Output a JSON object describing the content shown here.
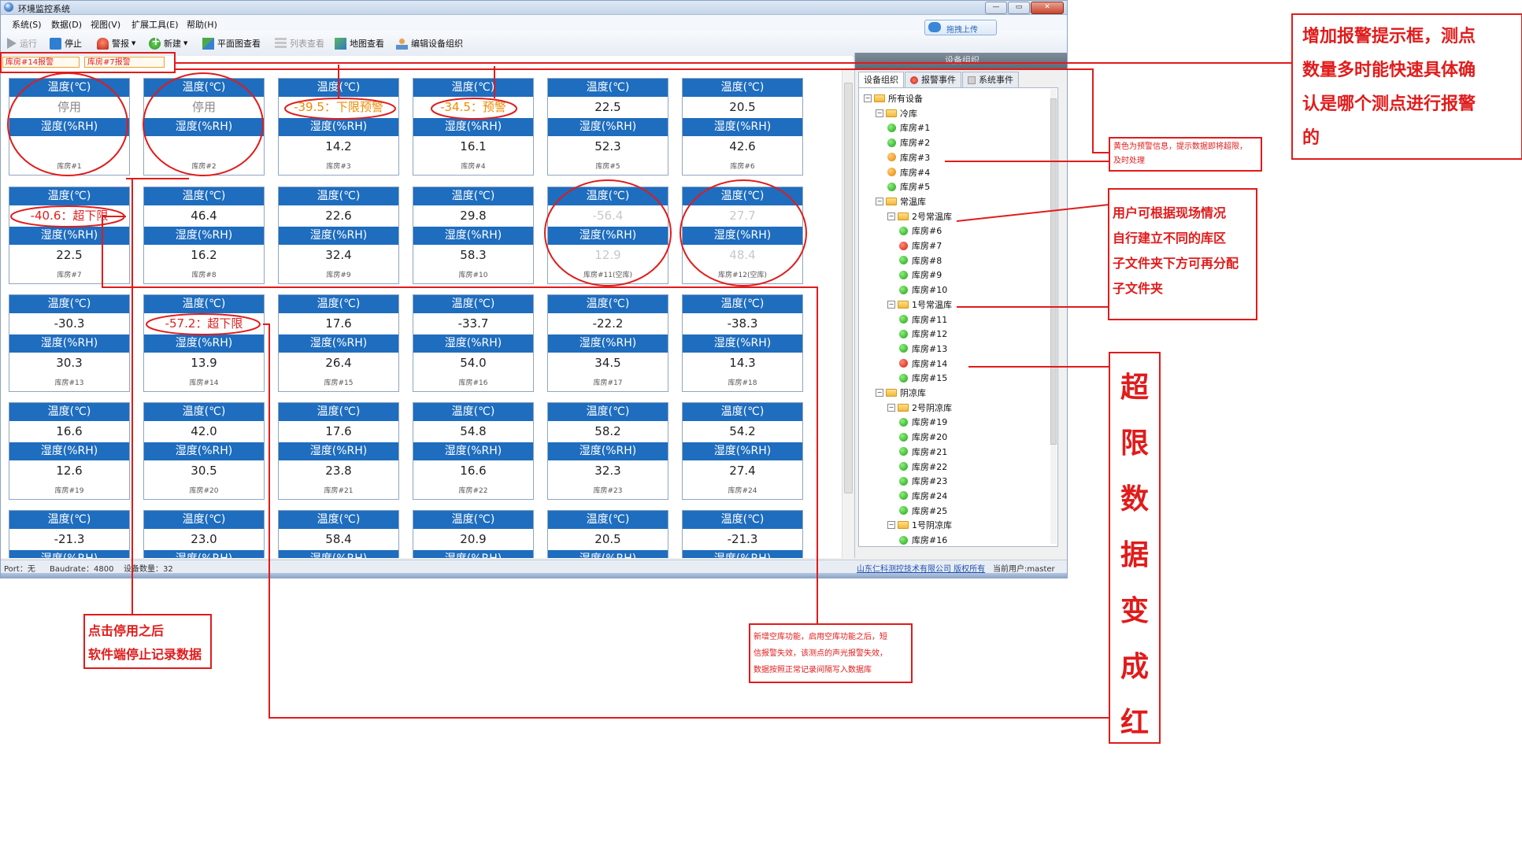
{
  "window": {
    "title": "环境监控系统",
    "buttons": [
      "—",
      "▭",
      "✕"
    ]
  },
  "menu": [
    "系统(S)",
    "数据(D)",
    "视图(V)",
    "扩展工具(E)",
    "帮助(H)"
  ],
  "toolbar": {
    "run": "运行",
    "stop": "停止",
    "alarm": "警报",
    "new": "新建",
    "plan": "平面图查看",
    "list": "列表查看",
    "map": "地图查看",
    "edit": "编辑设备组织",
    "upload": "拖拽上传"
  },
  "alarm_bar": [
    "库房#14报警",
    "库房#7报警"
  ],
  "labels": {
    "temp": "温度(℃)",
    "hum": "湿度(%RH)"
  },
  "cards": [
    {
      "name": "库房#1",
      "temp": "停用",
      "hum": "",
      "ts": "stop",
      "hs": ""
    },
    {
      "name": "库房#2",
      "temp": "停用",
      "hum": "",
      "ts": "stop",
      "hs": ""
    },
    {
      "name": "库房#3",
      "temp": "-39.5：下限预警",
      "hum": "14.2",
      "ts": "warn",
      "hs": ""
    },
    {
      "name": "库房#4",
      "temp": "-34.5：预警",
      "hum": "16.1",
      "ts": "warn",
      "hs": ""
    },
    {
      "name": "库房#5",
      "temp": "22.5",
      "hum": "52.3",
      "ts": "",
      "hs": ""
    },
    {
      "name": "库房#6",
      "temp": "20.5",
      "hum": "42.6",
      "ts": "",
      "hs": ""
    },
    {
      "name": "库房#7",
      "temp": "-40.6：超下限",
      "hum": "22.5",
      "ts": "alarm",
      "hs": ""
    },
    {
      "name": "库房#8",
      "temp": "46.4",
      "hum": "16.2",
      "ts": "",
      "hs": ""
    },
    {
      "name": "库房#9",
      "temp": "22.6",
      "hum": "32.4",
      "ts": "",
      "hs": ""
    },
    {
      "name": "库房#10",
      "temp": "29.8",
      "hum": "58.3",
      "ts": "",
      "hs": ""
    },
    {
      "name": "库房#11(空库)",
      "temp": "-56.4",
      "hum": "12.9",
      "ts": "empty",
      "hs": "empty"
    },
    {
      "name": "库房#12(空库)",
      "temp": "27.7",
      "hum": "48.4",
      "ts": "empty",
      "hs": "empty"
    },
    {
      "name": "库房#13",
      "temp": "-30.3",
      "hum": "30.3",
      "ts": "",
      "hs": ""
    },
    {
      "name": "库房#14",
      "temp": "-57.2：超下限",
      "hum": "13.9",
      "ts": "alarm",
      "hs": ""
    },
    {
      "name": "库房#15",
      "temp": "17.6",
      "hum": "26.4",
      "ts": "",
      "hs": ""
    },
    {
      "name": "库房#16",
      "temp": "-33.7",
      "hum": "54.0",
      "ts": "",
      "hs": ""
    },
    {
      "name": "库房#17",
      "temp": "-22.2",
      "hum": "34.5",
      "ts": "",
      "hs": ""
    },
    {
      "name": "库房#18",
      "temp": "-38.3",
      "hum": "14.3",
      "ts": "",
      "hs": ""
    },
    {
      "name": "库房#19",
      "temp": "16.6",
      "hum": "12.6",
      "ts": "",
      "hs": ""
    },
    {
      "name": "库房#20",
      "temp": "42.0",
      "hum": "30.5",
      "ts": "",
      "hs": ""
    },
    {
      "name": "库房#21",
      "temp": "17.6",
      "hum": "23.8",
      "ts": "",
      "hs": ""
    },
    {
      "name": "库房#22",
      "temp": "54.8",
      "hum": "16.6",
      "ts": "",
      "hs": ""
    },
    {
      "name": "库房#23",
      "temp": "58.2",
      "hum": "32.3",
      "ts": "",
      "hs": ""
    },
    {
      "name": "库房#24",
      "temp": "54.2",
      "hum": "27.4",
      "ts": "",
      "hs": ""
    },
    {
      "name": "",
      "temp": "-21.3",
      "hum": "",
      "ts": "",
      "hs": ""
    },
    {
      "name": "",
      "temp": "23.0",
      "hum": "",
      "ts": "",
      "hs": ""
    },
    {
      "name": "",
      "temp": "58.4",
      "hum": "",
      "ts": "",
      "hs": ""
    },
    {
      "name": "",
      "temp": "20.9",
      "hum": "",
      "ts": "",
      "hs": ""
    },
    {
      "name": "",
      "temp": "20.5",
      "hum": "",
      "ts": "",
      "hs": ""
    },
    {
      "name": "",
      "temp": "-21.3",
      "hum": "",
      "ts": "",
      "hs": ""
    }
  ],
  "panel": {
    "title": "设备组织",
    "tabs": [
      "设备组织",
      "报警事件",
      "系统事件"
    ]
  },
  "tree": [
    {
      "level": 0,
      "kind": "folder",
      "label": "所有设备"
    },
    {
      "level": 1,
      "kind": "folder",
      "label": "冷库"
    },
    {
      "level": 2,
      "kind": "leaf",
      "status": "green",
      "label": "库房#1"
    },
    {
      "level": 2,
      "kind": "leaf",
      "status": "green",
      "label": "库房#2"
    },
    {
      "level": 2,
      "kind": "leaf",
      "status": "orange",
      "label": "库房#3"
    },
    {
      "level": 2,
      "kind": "leaf",
      "status": "orange",
      "label": "库房#4"
    },
    {
      "level": 2,
      "kind": "leaf",
      "status": "green",
      "label": "库房#5"
    },
    {
      "level": 1,
      "kind": "folder",
      "label": "常温库"
    },
    {
      "level": 2,
      "kind": "folder",
      "label": "2号常温库"
    },
    {
      "level": 3,
      "kind": "leaf",
      "status": "green",
      "label": "库房#6"
    },
    {
      "level": 3,
      "kind": "leaf",
      "status": "red",
      "label": "库房#7"
    },
    {
      "level": 3,
      "kind": "leaf",
      "status": "green",
      "label": "库房#8"
    },
    {
      "level": 3,
      "kind": "leaf",
      "status": "green",
      "label": "库房#9"
    },
    {
      "level": 3,
      "kind": "leaf",
      "status": "green",
      "label": "库房#10"
    },
    {
      "level": 2,
      "kind": "folder",
      "label": "1号常温库"
    },
    {
      "level": 3,
      "kind": "leaf",
      "status": "green",
      "label": "库房#11"
    },
    {
      "level": 3,
      "kind": "leaf",
      "status": "green",
      "label": "库房#12"
    },
    {
      "level": 3,
      "kind": "leaf",
      "status": "green",
      "label": "库房#13"
    },
    {
      "level": 3,
      "kind": "leaf",
      "status": "red",
      "label": "库房#14"
    },
    {
      "level": 3,
      "kind": "leaf",
      "status": "green",
      "label": "库房#15"
    },
    {
      "level": 1,
      "kind": "folder",
      "label": "阴凉库"
    },
    {
      "level": 2,
      "kind": "folder",
      "label": "2号阴凉库"
    },
    {
      "level": 3,
      "kind": "leaf",
      "status": "green",
      "label": "库房#19"
    },
    {
      "level": 3,
      "kind": "leaf",
      "status": "green",
      "label": "库房#20"
    },
    {
      "level": 3,
      "kind": "leaf",
      "status": "green",
      "label": "库房#21"
    },
    {
      "level": 3,
      "kind": "leaf",
      "status": "green",
      "label": "库房#22"
    },
    {
      "level": 3,
      "kind": "leaf",
      "status": "green",
      "label": "库房#23"
    },
    {
      "level": 3,
      "kind": "leaf",
      "status": "green",
      "label": "库房#24"
    },
    {
      "level": 3,
      "kind": "leaf",
      "status": "green",
      "label": "库房#25"
    },
    {
      "level": 2,
      "kind": "folder",
      "label": "1号阴凉库"
    },
    {
      "level": 3,
      "kind": "leaf",
      "status": "green",
      "label": "库房#16"
    }
  ],
  "status": {
    "port": "Port：无",
    "baud": "Baudrate：4800",
    "count": "设备数量：32",
    "company": "山东仁科测控技术有限公司 版权所有",
    "user": "当前用户:master"
  },
  "annotations": {
    "big": "增加报警提示框，测点\n数量多时能快速具体确\n认是哪个测点进行报警\n的",
    "yellow": "黄色为预警信息，提示数据即将超限，\n及时处理",
    "folder": "用户可根据现场情况\n自行建立不同的库区\n子文件夹下方可再分配\n子文件夹",
    "vertical": "超\n限\n数\n据\n变\n成\n红",
    "stop": "点击停用之后\n软件端停止记录数据",
    "empty": "新增空库功能，启用空库功能之后，短\n信报警失效，该测点的声光报警失效，\n数据按照正常记录间隔写入数据库"
  },
  "colors": {
    "header_blue": "#1e6dbf",
    "alarm_red": "#e02020",
    "warn_orange": "#ee8a00",
    "annotation_red": "#e11b1b"
  }
}
